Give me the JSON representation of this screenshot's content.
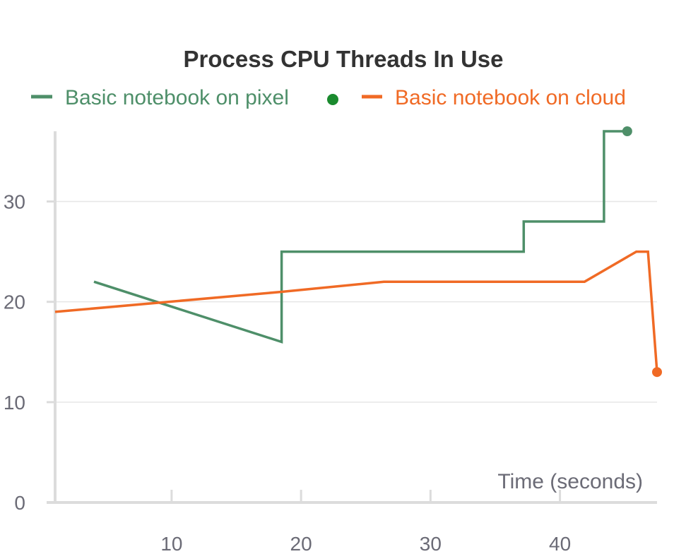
{
  "chart_data": {
    "type": "line",
    "title": "Process CPU Threads In Use",
    "xlabel": "Time (seconds)",
    "ylabel": "",
    "xlim": [
      1,
      47.5
    ],
    "ylim": [
      0,
      37
    ],
    "xticks": [
      10,
      20,
      30,
      40
    ],
    "yticks": [
      0,
      10,
      20,
      30
    ],
    "grid": true,
    "legend_position": "top",
    "series": [
      {
        "name": "Basic notebook on pixel",
        "color": "#4e8f69",
        "points": [
          [
            4,
            22
          ],
          [
            18.5,
            16
          ],
          [
            18.5,
            25
          ],
          [
            37.2,
            25
          ],
          [
            37.2,
            28
          ],
          [
            43.4,
            28
          ],
          [
            43.4,
            37
          ],
          [
            45.2,
            37
          ]
        ]
      },
      {
        "name": "Basic notebook on cloud",
        "color": "#f06a25",
        "points": [
          [
            1,
            19
          ],
          [
            18.5,
            21
          ],
          [
            26.4,
            22
          ],
          [
            41.9,
            22
          ],
          [
            45.9,
            25
          ],
          [
            46.8,
            25
          ],
          [
            47.5,
            13
          ]
        ]
      }
    ]
  }
}
